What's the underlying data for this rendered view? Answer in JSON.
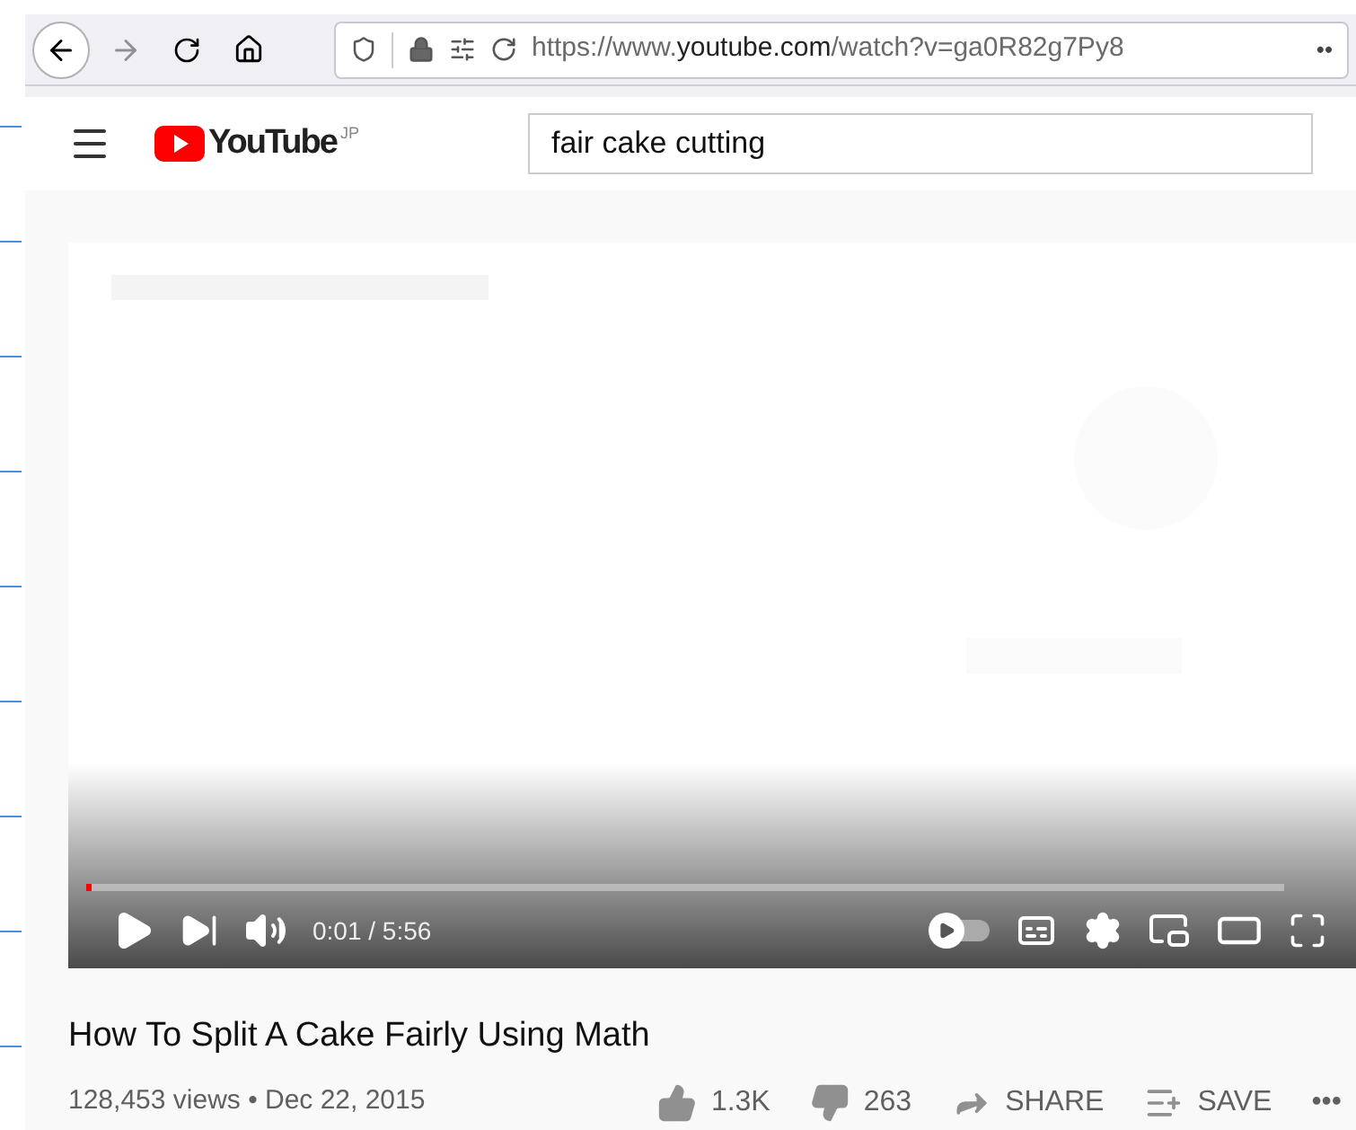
{
  "browser": {
    "address": {
      "prefix": "https://www.",
      "domain": "youtube.com",
      "path": "/watch?v=ga0R82g7Py8"
    },
    "more": "••"
  },
  "header": {
    "logo_text": "YouTube",
    "region": "JP",
    "search": {
      "value": "fair cake cutting"
    }
  },
  "player": {
    "progress": {
      "level": 0.003
    },
    "time": "0:01 / 5:56",
    "autoplay": {
      "on": false
    }
  },
  "video": {
    "title": "How To Split A Cake Fairly Using Math",
    "meta": "128,453 views • Dec 22, 2015",
    "actions": [
      {
        "kind": "like",
        "label": "1.3K"
      },
      {
        "kind": "dislike",
        "label": "263"
      },
      {
        "kind": "share",
        "label": "SHARE"
      },
      {
        "kind": "save",
        "label": "SAVE"
      },
      {
        "kind": "more",
        "label": "•••"
      }
    ]
  }
}
